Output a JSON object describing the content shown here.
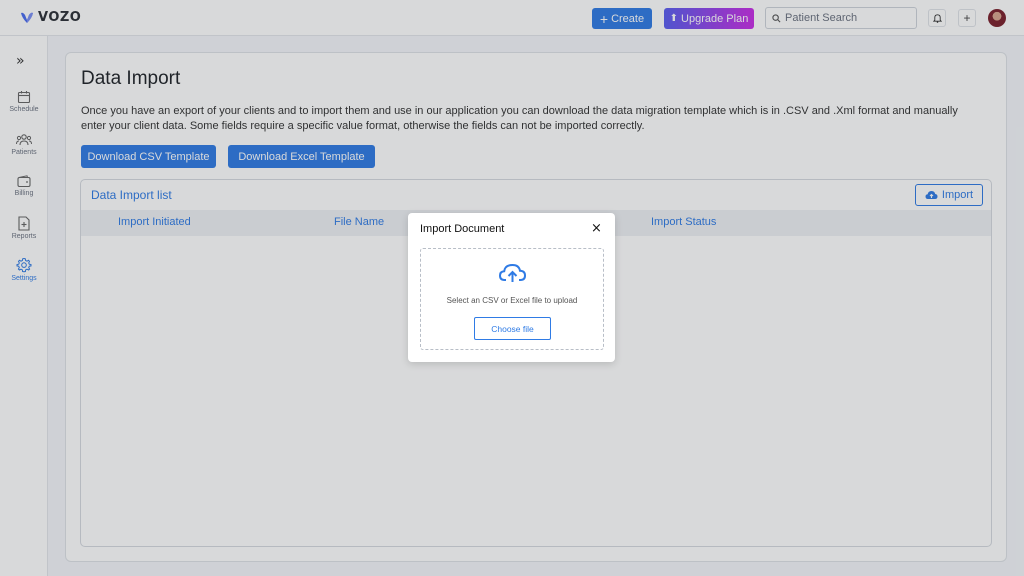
{
  "app": {
    "brand": "VOZO"
  },
  "header": {
    "create_label": "Create",
    "upgrade_label": "Upgrade Plan",
    "search_placeholder": "Patient Search"
  },
  "sidebar": {
    "items": [
      {
        "label": "Schedule",
        "icon": "calendar-icon"
      },
      {
        "label": "Patients",
        "icon": "patients-icon"
      },
      {
        "label": "Billing",
        "icon": "wallet-icon"
      },
      {
        "label": "Reports",
        "icon": "report-icon"
      },
      {
        "label": "Settings",
        "icon": "gear-icon",
        "active": true
      }
    ]
  },
  "page": {
    "title": "Data Import",
    "description": "Once you have an export of your clients and to import them and use in our application you can download the data migration template which is in .CSV and .Xml format and manually enter your client data. Some fields require a specific value format, otherwise the fields can not be imported correctly.",
    "download_csv_label": "Download CSV Template",
    "download_excel_label": "Download Excel Template"
  },
  "import_list": {
    "title": "Data Import list",
    "import_button_label": "Import",
    "columns": [
      "Import Initiated",
      "File Name",
      "Import Status"
    ]
  },
  "modal": {
    "title": "Import Document",
    "close_symbol": "×",
    "drop_text": "Select an CSV or Excel file to upload",
    "choose_label": "Choose file"
  },
  "colors": {
    "primary": "#2f7be5",
    "upgrade_gradient_start": "#5a5ef0",
    "upgrade_gradient_end": "#c92de6"
  }
}
